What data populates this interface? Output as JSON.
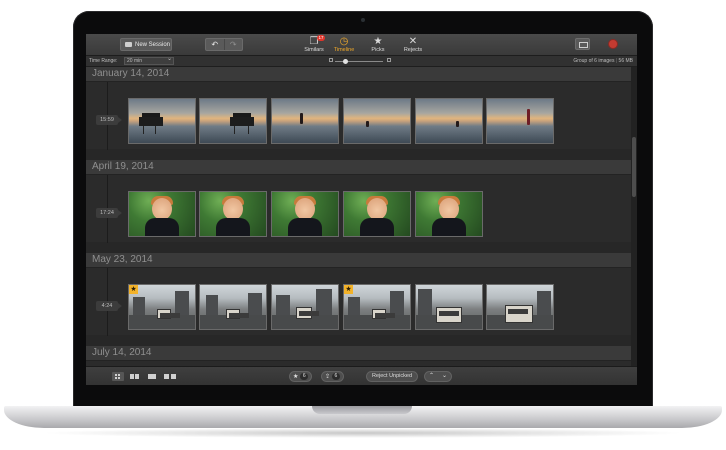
{
  "toolbar": {
    "new_session_label": "New Session",
    "undo_icon": "undo-arrow-icon",
    "redo_icon": "redo-arrow-icon",
    "modes": [
      {
        "label": "Similars",
        "icon": "stack-icon",
        "badge": "17"
      },
      {
        "label": "Timeline",
        "icon": "clock-icon",
        "active": true
      },
      {
        "label": "Picks",
        "icon": "star-icon"
      },
      {
        "label": "Rejects",
        "icon": "x-icon"
      }
    ],
    "right_icons": [
      "image-view-icon",
      "stop-record-icon"
    ]
  },
  "subbar": {
    "time_range_label": "Time Range:",
    "time_range_value": "20 min",
    "group_info": "Group of 6 images",
    "size_info": "56 MB"
  },
  "sections": [
    {
      "date": "January 14, 2014",
      "time": "15:59",
      "photos": 6,
      "theme": "sunset"
    },
    {
      "date": "April 19, 2014",
      "time": "17:24",
      "photos": 5,
      "theme": "kid"
    },
    {
      "date": "May 23, 2014",
      "time": "4:24",
      "photos": 6,
      "theme": "city",
      "picked": [
        1,
        4
      ]
    },
    {
      "date": "July 14, 2014"
    }
  ],
  "bottombar": {
    "views": [
      "grid-view-icon",
      "two-up-icon",
      "single-view-icon",
      "compare-view-icon"
    ],
    "picks_count": "6",
    "shares_count": "6",
    "reject_unpicked_label": "Reject Unpicked",
    "nav_up": "⌃",
    "nav_down": "⌄"
  },
  "colors": {
    "accent": "#f0a92a",
    "badge": "#e0342a",
    "pick_star": "#f2b22a"
  }
}
